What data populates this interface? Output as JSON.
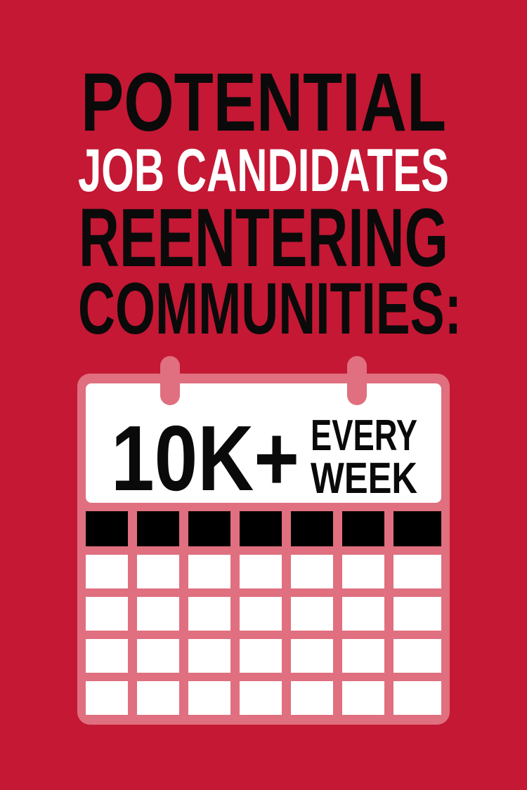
{
  "headline": {
    "line1": "POTENTIAL",
    "line2": "JOB CANDIDATES",
    "line3": "REENTERING",
    "line4": "COMMUNITIES:"
  },
  "calendar": {
    "big_number": "10K+",
    "label_line1": "EVERY",
    "label_line2": "WEEK"
  },
  "colors": {
    "background": "#c41834",
    "frame": "#e06f7f",
    "text_dark": "#0a0a0a",
    "text_light": "#ffffff",
    "cell": "#ffffff",
    "header_cell": "#000000"
  },
  "icons": [
    "calendar-icon",
    "calendar-ring-icon"
  ]
}
